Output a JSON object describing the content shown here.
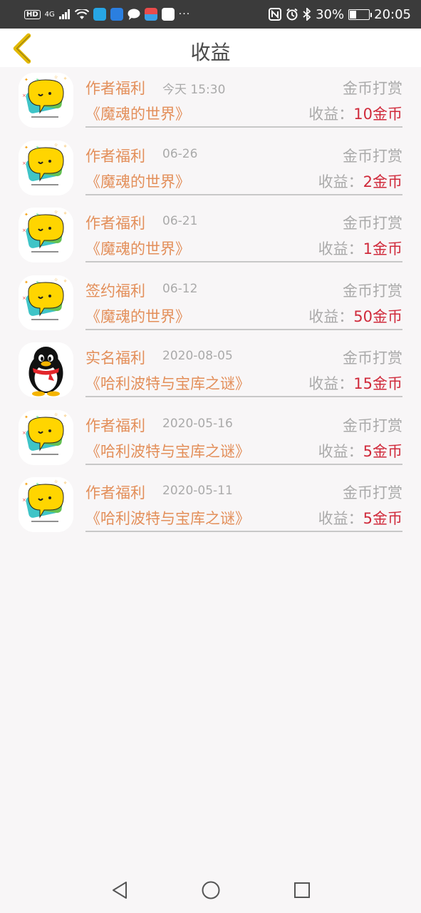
{
  "status_bar": {
    "left_badge": "HD",
    "signal": "4G",
    "dots": "···",
    "battery": "30%",
    "battery_level": 0.3,
    "time": "20:05"
  },
  "header": {
    "title": "收益"
  },
  "list": [
    {
      "avatar": "yellow-chat-icon",
      "type": "作者福利",
      "date": "今天 15:30",
      "category": "金币打赏",
      "book": "《魔魂的世界》",
      "earn_label": "收益：",
      "earn_value": "10金币"
    },
    {
      "avatar": "yellow-chat-icon",
      "type": "作者福利",
      "date": "06-26",
      "category": "金币打赏",
      "book": "《魔魂的世界》",
      "earn_label": "收益：",
      "earn_value": "2金币"
    },
    {
      "avatar": "yellow-chat-icon",
      "type": "作者福利",
      "date": "06-21",
      "category": "金币打赏",
      "book": "《魔魂的世界》",
      "earn_label": "收益：",
      "earn_value": "1金币"
    },
    {
      "avatar": "yellow-chat-icon",
      "type": "签约福利",
      "date": "06-12",
      "category": "金币打赏",
      "book": "《魔魂的世界》",
      "earn_label": "收益：",
      "earn_value": "50金币"
    },
    {
      "avatar": "qq-penguin-icon",
      "type": "实名福利",
      "date": "2020-08-05",
      "category": "金币打赏",
      "book": "《哈利波特与宝库之谜》",
      "earn_label": "收益：",
      "earn_value": "15金币"
    },
    {
      "avatar": "yellow-chat-icon",
      "type": "作者福利",
      "date": "2020-05-16",
      "category": "金币打赏",
      "book": "《哈利波特与宝库之谜》",
      "earn_label": "收益：",
      "earn_value": "5金币"
    },
    {
      "avatar": "yellow-chat-icon",
      "type": "作者福利",
      "date": "2020-05-11",
      "category": "金币打赏",
      "book": "《哈利波特与宝库之谜》",
      "earn_label": "收益：",
      "earn_value": "5金币"
    }
  ],
  "colors": {
    "accent_orange": "#e38f5a",
    "value_red": "#d02a3b",
    "muted_gray": "#aaaaaa",
    "back_arrow": "#e2b800"
  }
}
